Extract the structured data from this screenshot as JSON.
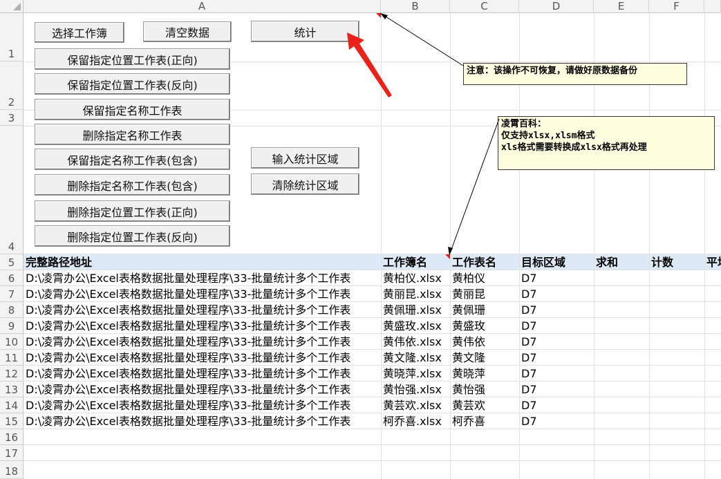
{
  "columns": [
    "A",
    "B",
    "C",
    "D",
    "E",
    "F"
  ],
  "row_numbers": [
    "1",
    "2",
    "3",
    "4",
    "5",
    "6",
    "7",
    "8",
    "9",
    "10",
    "11",
    "12",
    "13",
    "14",
    "15",
    "16",
    "17",
    "18"
  ],
  "buttons": {
    "select_workbook": "选择工作簿",
    "clear_data": "清空数据",
    "stats": "统计",
    "keep_pos_fwd": "保留指定位置工作表(正向)",
    "keep_pos_rev": "保留指定位置工作表(反向)",
    "keep_name": "保留指定名称工作表",
    "delete_name": "删除指定名称工作表",
    "keep_name_contains": "保留指定名称工作表(包含)",
    "delete_name_contains": "删除指定名称工作表(包含)",
    "delete_pos_fwd": "删除指定位置工作表(正向)",
    "delete_pos_rev": "删除指定位置工作表(反向)",
    "input_area": "输入统计区域",
    "clear_area": "清除统计区域"
  },
  "notes": {
    "warning": "注意：该操作不可恢复，请做好原数据备份",
    "info_line1": "凌霄百科：",
    "info_line2": "仅支持xlsx,xlsm格式",
    "info_line3": "xls格式需要转换成xlsx格式再处理"
  },
  "table": {
    "headers": [
      "完整路径地址",
      "工作簿名",
      "工作表名",
      "目标区域",
      "求和",
      "计数",
      "平均"
    ],
    "rows": [
      [
        "D:\\凌霄办公\\Excel表格数据批量处理程序\\33-批量统计多个工作表",
        "黄柏仪.xlsx",
        "黄柏仪",
        "D7"
      ],
      [
        "D:\\凌霄办公\\Excel表格数据批量处理程序\\33-批量统计多个工作表",
        "黄丽昆.xlsx",
        "黄丽昆",
        "D7"
      ],
      [
        "D:\\凌霄办公\\Excel表格数据批量处理程序\\33-批量统计多个工作表",
        "黄佩珊.xlsx",
        "黄佩珊",
        "D7"
      ],
      [
        "D:\\凌霄办公\\Excel表格数据批量处理程序\\33-批量统计多个工作表",
        "黄盛玫.xlsx",
        "黄盛玫",
        "D7"
      ],
      [
        "D:\\凌霄办公\\Excel表格数据批量处理程序\\33-批量统计多个工作表",
        "黄伟依.xlsx",
        "黄伟依",
        "D7"
      ],
      [
        "D:\\凌霄办公\\Excel表格数据批量处理程序\\33-批量统计多个工作表",
        "黄文隆.xlsx",
        "黄文隆",
        "D7"
      ],
      [
        "D:\\凌霄办公\\Excel表格数据批量处理程序\\33-批量统计多个工作表",
        "黄晓萍.xlsx",
        "黄晓萍",
        "D7"
      ],
      [
        "D:\\凌霄办公\\Excel表格数据批量处理程序\\33-批量统计多个工作表",
        "黄怡强.xlsx",
        "黄怡强",
        "D7"
      ],
      [
        "D:\\凌霄办公\\Excel表格数据批量处理程序\\33-批量统计多个工作表",
        "黄芸欢.xlsx",
        "黄芸欢",
        "D7"
      ],
      [
        "D:\\凌霄办公\\Excel表格数据批量处理程序\\33-批量统计多个工作表",
        "柯乔喜.xlsx",
        "柯乔喜",
        "D7"
      ]
    ]
  },
  "colors": {
    "header_fill": "#dde9f6",
    "note_fill": "#ffffe1",
    "arrow_red": "#e8231c"
  }
}
